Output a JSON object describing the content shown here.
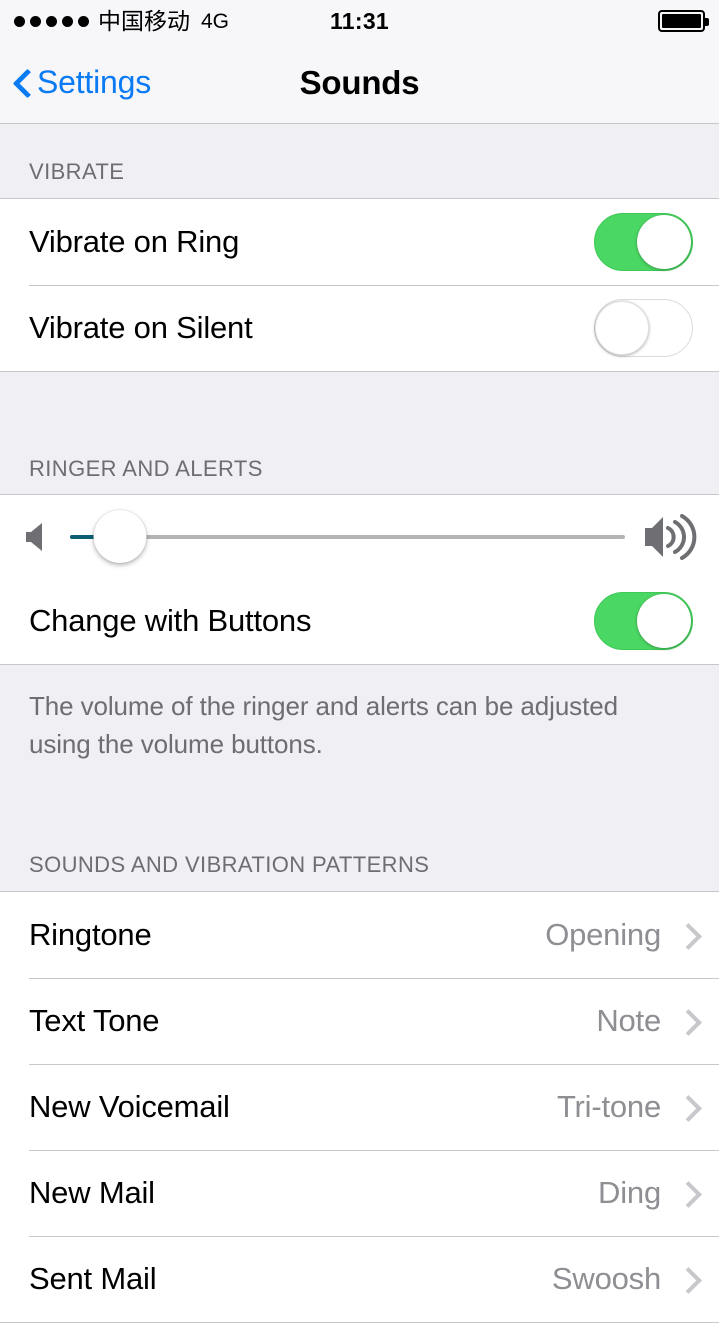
{
  "status_bar": {
    "signal_dots": 5,
    "carrier": "中国移动",
    "network": "4G",
    "time": "11:31",
    "battery_level_percent": 100
  },
  "nav_bar": {
    "back_label": "Settings",
    "title": "Sounds"
  },
  "sections": {
    "vibrate": {
      "header": "VIBRATE",
      "rows": [
        {
          "label": "Vibrate on Ring",
          "toggle": "on"
        },
        {
          "label": "Vibrate on Silent",
          "toggle": "off"
        }
      ]
    },
    "ringer": {
      "header": "RINGER AND ALERTS",
      "slider": {
        "value_percent": 9,
        "left_icon": "speaker-low-icon",
        "right_icon": "speaker-high-icon"
      },
      "change_with_buttons": {
        "label": "Change with Buttons",
        "toggle": "on"
      },
      "footer": "The volume of the ringer and alerts can be adjusted using the volume buttons."
    },
    "sounds_patterns": {
      "header": "SOUNDS AND VIBRATION PATTERNS",
      "rows": [
        {
          "label": "Ringtone",
          "value": "Opening"
        },
        {
          "label": "Text Tone",
          "value": "Note"
        },
        {
          "label": "New Voicemail",
          "value": "Tri-tone"
        },
        {
          "label": "New Mail",
          "value": "Ding"
        },
        {
          "label": "Sent Mail",
          "value": "Swoosh"
        }
      ]
    }
  },
  "colors": {
    "accent_blue": "#0b7bf4",
    "switch_on_green": "#4BD763",
    "group_background": "#EFEFF4",
    "value_gray": "#8E8E93",
    "chevron_gray": "#C7C7CC",
    "separator": "#C8C7CC"
  }
}
